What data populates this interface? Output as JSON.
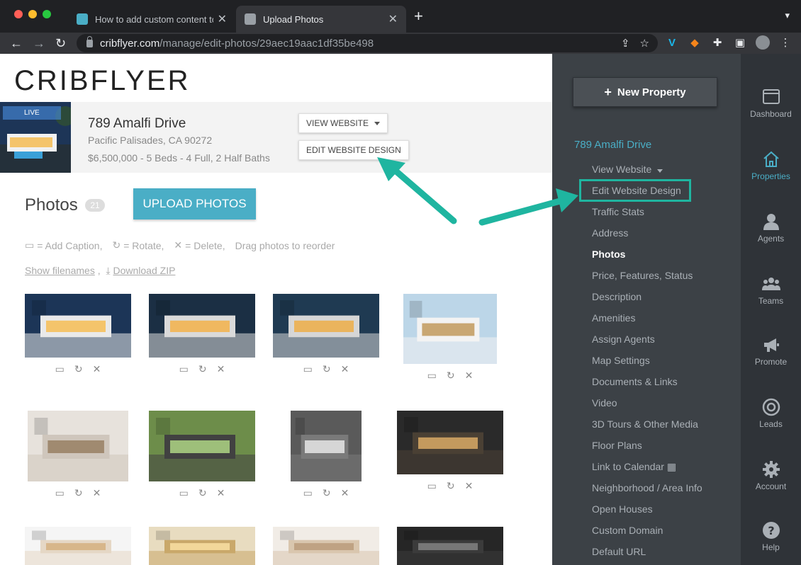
{
  "browser": {
    "tabs": [
      {
        "title": "How to add custom content to",
        "active": false
      },
      {
        "title": "Upload Photos",
        "active": true
      }
    ],
    "url_host": "cribflyer.com",
    "url_path": "/manage/edit-photos/29aec19aac1df35be498"
  },
  "page": {
    "logo": "CRIBFLYER",
    "property": {
      "badge": "LIVE",
      "title": "789 Amalfi Drive",
      "location": "Pacific Palisades, CA 90272",
      "meta": "$6,500,000 - 5 Beds - 4 Full, 2 Half Baths",
      "view_website_label": "VIEW WEBSITE",
      "edit_design_label": "EDIT WEBSITE DESIGN"
    },
    "photos": {
      "title": "Photos",
      "count": "21",
      "upload_label": "UPLOAD PHOTOS",
      "help_caption": "= Add Caption,",
      "help_rotate": "= Rotate,",
      "help_delete": "= Delete,",
      "help_drag": "Drag photos to reorder",
      "show_filenames": "Show filenames",
      "links_sep": ",",
      "download_zip": "Download ZIP"
    }
  },
  "sidebar": {
    "new_property": "New Property",
    "property_name": "789 Amalfi Drive",
    "items": [
      "View Website",
      "Edit Website Design",
      "Traffic Stats",
      "Address",
      "Photos",
      "Price, Features, Status",
      "Description",
      "Amenities",
      "Assign Agents",
      "Map Settings",
      "Documents & Links",
      "Video",
      "3D Tours & Other Media",
      "Floor Plans",
      "Link to Calendar",
      "Neighborhood / Area Info",
      "Open Houses",
      "Custom Domain",
      "Default URL"
    ],
    "active_item": "Photos"
  },
  "rail": {
    "items": [
      "Dashboard",
      "Properties",
      "Agents",
      "Teams",
      "Promote",
      "Leads",
      "Account",
      "Help"
    ],
    "active": "Properties"
  },
  "colors": {
    "accent": "#4aaec6",
    "annotation": "#1fb5a0",
    "sidebar_bg": "#3c4146",
    "rail_bg": "#2f3338"
  }
}
